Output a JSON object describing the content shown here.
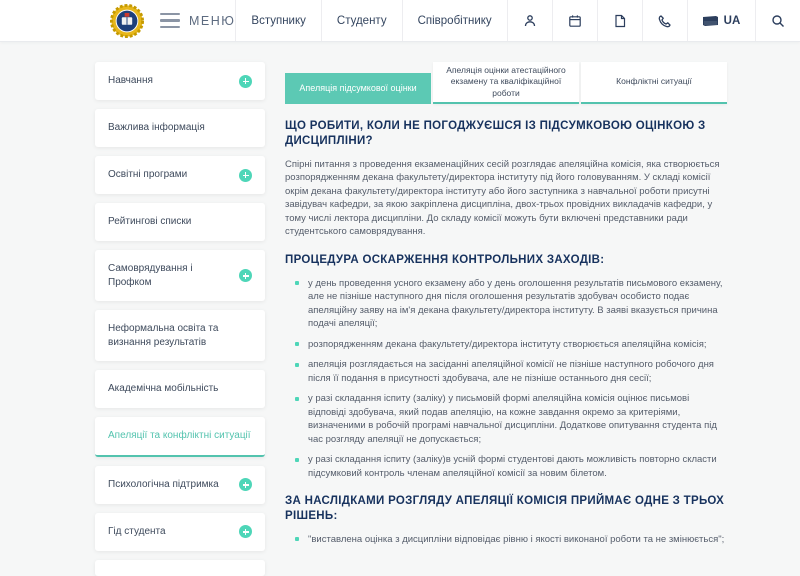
{
  "colors": {
    "accent": "#5cc9b4",
    "heading": "#17325e"
  },
  "header": {
    "menu_label": "МЕНЮ",
    "nav": [
      {
        "label": "Вступнику"
      },
      {
        "label": "Студенту"
      },
      {
        "label": "Співробітнику"
      }
    ],
    "icons": [
      "person-icon",
      "calendar-icon",
      "document-icon",
      "phone-icon"
    ],
    "language": "UA"
  },
  "sidebar": {
    "items": [
      {
        "label": "Навчання",
        "expandable": true,
        "active": false
      },
      {
        "label": "Важлива інформація",
        "expandable": false,
        "active": false
      },
      {
        "label": "Освітні програми",
        "expandable": true,
        "active": false
      },
      {
        "label": "Рейтингові списки",
        "expandable": false,
        "active": false
      },
      {
        "label": "Самоврядування і Профком",
        "expandable": true,
        "active": false
      },
      {
        "label": "Неформальна освіта та визнання результатів",
        "expandable": false,
        "active": false
      },
      {
        "label": "Академічна мобільність",
        "expandable": false,
        "active": false
      },
      {
        "label": "Апеляції та конфліктні ситуації",
        "expandable": false,
        "active": true
      },
      {
        "label": "Психологічна підтримка",
        "expandable": true,
        "active": false
      },
      {
        "label": "Гід студента",
        "expandable": true,
        "active": false
      }
    ]
  },
  "tabs": [
    {
      "label": "Апеляція підсумкової оцінки",
      "active": true
    },
    {
      "label": "Апеляція оцінки атестаційного екзамену та кваліфікаційної роботи",
      "active": false
    },
    {
      "label": "Конфліктні ситуації",
      "active": false
    }
  ],
  "content": {
    "heading1": "ЩО РОБИТИ, КОЛИ НЕ ПОГОДЖУЄШСЯ ІЗ ПІДСУМКОВОЮ ОЦІНКОЮ З ДИСЦИПЛІНИ?",
    "paragraph1": "Спірні питання з проведення екзаменаційних сесій розглядає апеляційна комісія, яка створюється розпорядженням декана факультету/директора інституту під його головуванням. У складі комісії окрім декана факультету/директора інституту або його заступника з навчальної роботи присутні завідувач кафедри, за якою закріплена дисципліна, двох-трьох провідних викладачів кафедри, у тому числі лектора дисципліни. До складу комісії можуть бути включені представники ради студентського самоврядування.",
    "heading2": "ПРОЦЕДУРА ОСКАРЖЕННЯ КОНТРОЛЬНИХ ЗАХОДІВ:",
    "bullets": [
      "у день проведення усного екзамену або у день оголошення результатів письмового екзамену, але не пізніше наступного дня після оголошення результатів здобувач особисто подає апеляційну заяву на ім'я декана факультету/директора інституту. В заяві вказується причина подачі апеляції;",
      "розпорядженням декана факультету/директора інституту створюється апеляційна комісія;",
      "апеляція розглядається на засіданні апеляційної комісії не пізніше наступного робочого дня після її подання в присутності здобувача, але не пізніше останнього дня сесії;",
      "у разі складання іспиту (заліку) у письмовій формі апеляційна комісія оцінює письмові відповіді здобувача, який подав апеляцію, на кожне завдання окремо за критеріями, визначеними в робочій програмі навчальної дисципліни. Додаткове опитування студента під час розгляду апеляції не допускається;",
      "у разі складання іспиту (заліку)в усній формі студентові дають можливість повторно скласти підсумковий контроль членам апеляційної комісії за новим білетом."
    ],
    "heading3": "ЗА НАСЛІДКАМИ РОЗГЛЯДУ АПЕЛЯЦІЇ КОМІСІЯ ПРИЙМАЄ ОДНЕ З ТРЬОХ РІШЕНЬ:",
    "bullets2": [
      "\"виставлена оцінка з дисципліни відповідає рівню і якості виконаної роботи та не змінюється\";"
    ]
  }
}
